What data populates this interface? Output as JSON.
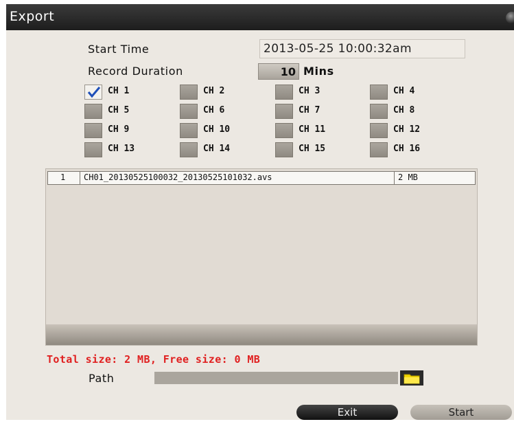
{
  "window": {
    "title": "Export"
  },
  "form": {
    "start_time_label": "Start Time",
    "start_time_value": "2013-05-25 10:00:32am",
    "record_duration_label": "Record Duration",
    "duration_value": "10",
    "duration_unit": "Mins"
  },
  "channels": [
    {
      "label": "CH 1",
      "checked": true
    },
    {
      "label": "CH 2",
      "checked": false
    },
    {
      "label": "CH 3",
      "checked": false
    },
    {
      "label": "CH 4",
      "checked": false
    },
    {
      "label": "CH 5",
      "checked": false
    },
    {
      "label": "CH 6",
      "checked": false
    },
    {
      "label": "CH 7",
      "checked": false
    },
    {
      "label": "CH 8",
      "checked": false
    },
    {
      "label": "CH 9",
      "checked": false
    },
    {
      "label": "CH 10",
      "checked": false
    },
    {
      "label": "CH 11",
      "checked": false
    },
    {
      "label": "CH 12",
      "checked": false
    },
    {
      "label": "CH 13",
      "checked": false
    },
    {
      "label": "CH 14",
      "checked": false
    },
    {
      "label": "CH 15",
      "checked": false
    },
    {
      "label": "CH 16",
      "checked": false
    }
  ],
  "file_list": [
    {
      "index": "1",
      "name": "CH01_20130525100032_20130525101032.avs",
      "size": "2 MB"
    }
  ],
  "size_info": "Total size: 2 MB, Free size: 0 MB",
  "path": {
    "label": "Path",
    "value": ""
  },
  "buttons": {
    "exit": "Exit",
    "start": "Start"
  },
  "icons": {
    "folder": "folder-icon",
    "check": "checkmark-icon"
  },
  "colors": {
    "warning_text": "#e02020",
    "checkmark": "#1f4fb8",
    "titlebar": "#2a2a2a",
    "folder": "#f2d600"
  }
}
